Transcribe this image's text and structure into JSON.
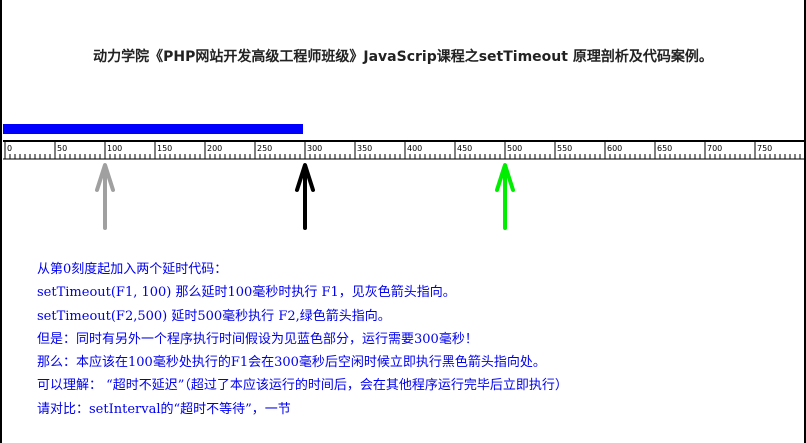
{
  "title": "动力学院《PHP网站开发高级工程师班级》JavaScrip课程之setTimeout 原理剖析及代码案例。",
  "ruler": {
    "labels": [
      "0",
      "50",
      "100",
      "150",
      "200",
      "250",
      "300",
      "350",
      "400",
      "450",
      "500",
      "550",
      "600",
      "650",
      "700",
      "750"
    ]
  },
  "timeline": {
    "blocked_ms": 300,
    "arrows": [
      {
        "name": "gray-arrow",
        "at_ms": 100,
        "color": "#a0a0a0"
      },
      {
        "name": "black-arrow",
        "at_ms": 300,
        "color": "#000000"
      },
      {
        "name": "green-arrow",
        "at_ms": 500,
        "color": "#00ee00"
      }
    ],
    "bar_color": "#0000ff"
  },
  "notes": [
    "从第0刻度起加入两个延时代码：",
    "setTimeout(F1, 100)   那么延时100毫秒时执行 F1，见灰色箭头指向。",
    "setTimeout(F2,500)   延时500毫秒执行   F2,绿色箭头指向。",
    "但是：同时有另外一个程序执行时间假设为见蓝色部分，运行需要300毫秒！",
    "那么：本应该在100毫秒处执行的F1会在300毫秒后空闲时候立即执行黑色箭头指向处。",
    "可以理解：  “超时不延迟”（超过了本应该运行的时间后，会在其他程序运行完毕后立即执行）",
    "请对比：setInterval的“超时不等待”，一节"
  ]
}
